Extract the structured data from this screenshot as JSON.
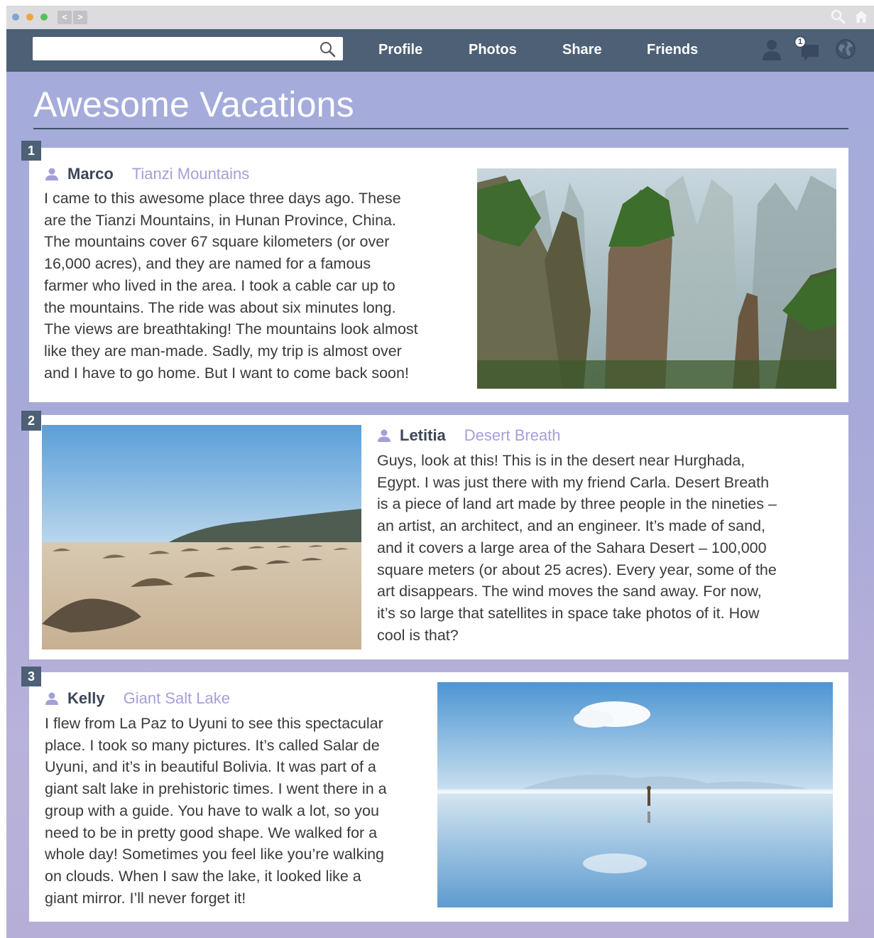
{
  "window": {
    "back_label": "<",
    "forward_label": ">"
  },
  "nav": {
    "search": {
      "value": "",
      "placeholder": ""
    },
    "links": [
      "Profile",
      "Photos",
      "Share",
      "Friends"
    ],
    "notification_count": "1",
    "icons": [
      "user-icon",
      "chat-icon",
      "globe-icon",
      "search-icon",
      "home-icon"
    ]
  },
  "page": {
    "title": "Awesome Vacations"
  },
  "posts": [
    {
      "number": "1",
      "author": "Marco",
      "place": "Tianzi Mountains",
      "lines": [
        "I came to this awesome place three days ago. These",
        "are the Tianzi Mountains, in Hunan Province, China.",
        "The mountains cover 67 square kilometers (or over",
        "16,000 acres), and they are named for a famous",
        "farmer who lived in the area. I took a cable car up to",
        "the mountains. The ride was about six minutes long.",
        "The views are breathtaking! The mountains look almost",
        "like they are man-made. Sadly, my trip is almost over",
        "and I have to go home. But I want to come back soon!"
      ]
    },
    {
      "number": "2",
      "author": "Letitia",
      "place": "Desert Breath",
      "lines": [
        "Guys, look at this! This is in the desert near Hurghada,",
        "Egypt. I was just there with my friend Carla. Desert Breath",
        "is a piece of land art made by three people in the nineties –",
        "an artist, an architect, and an engineer. It’s made of sand,",
        "and it covers a large area of the Sahara Desert – 100,000",
        "square meters (or about 25 acres). Every year, some of the",
        "art disappears. The wind moves the sand away. For now,",
        "it’s so large that satellites in space take photos of it. How",
        "cool is that?"
      ]
    },
    {
      "number": "3",
      "author": "Kelly",
      "place": "Giant Salt Lake",
      "lines": [
        "I flew from La Paz to Uyuni to see this spectacular",
        "place. I took so many pictures. It’s called Salar de",
        "Uyuni, and it’s in beautiful Bolivia. It was part of a",
        "giant salt lake in prehistoric times. I went there in a",
        "group with a guide. You have to walk a lot, so you",
        "need to be in pretty good shape. We walked for a",
        "whole day! Sometimes you feel like you’re walking",
        "on clouds. When I saw the lake, it looked like a",
        "giant mirror. I’ll never forget it!"
      ]
    }
  ],
  "colors": {
    "navbar": "#4d6076",
    "place_label": "#a3a0d8",
    "background": "#a7a9d8",
    "number_badge": "#4d6076"
  }
}
